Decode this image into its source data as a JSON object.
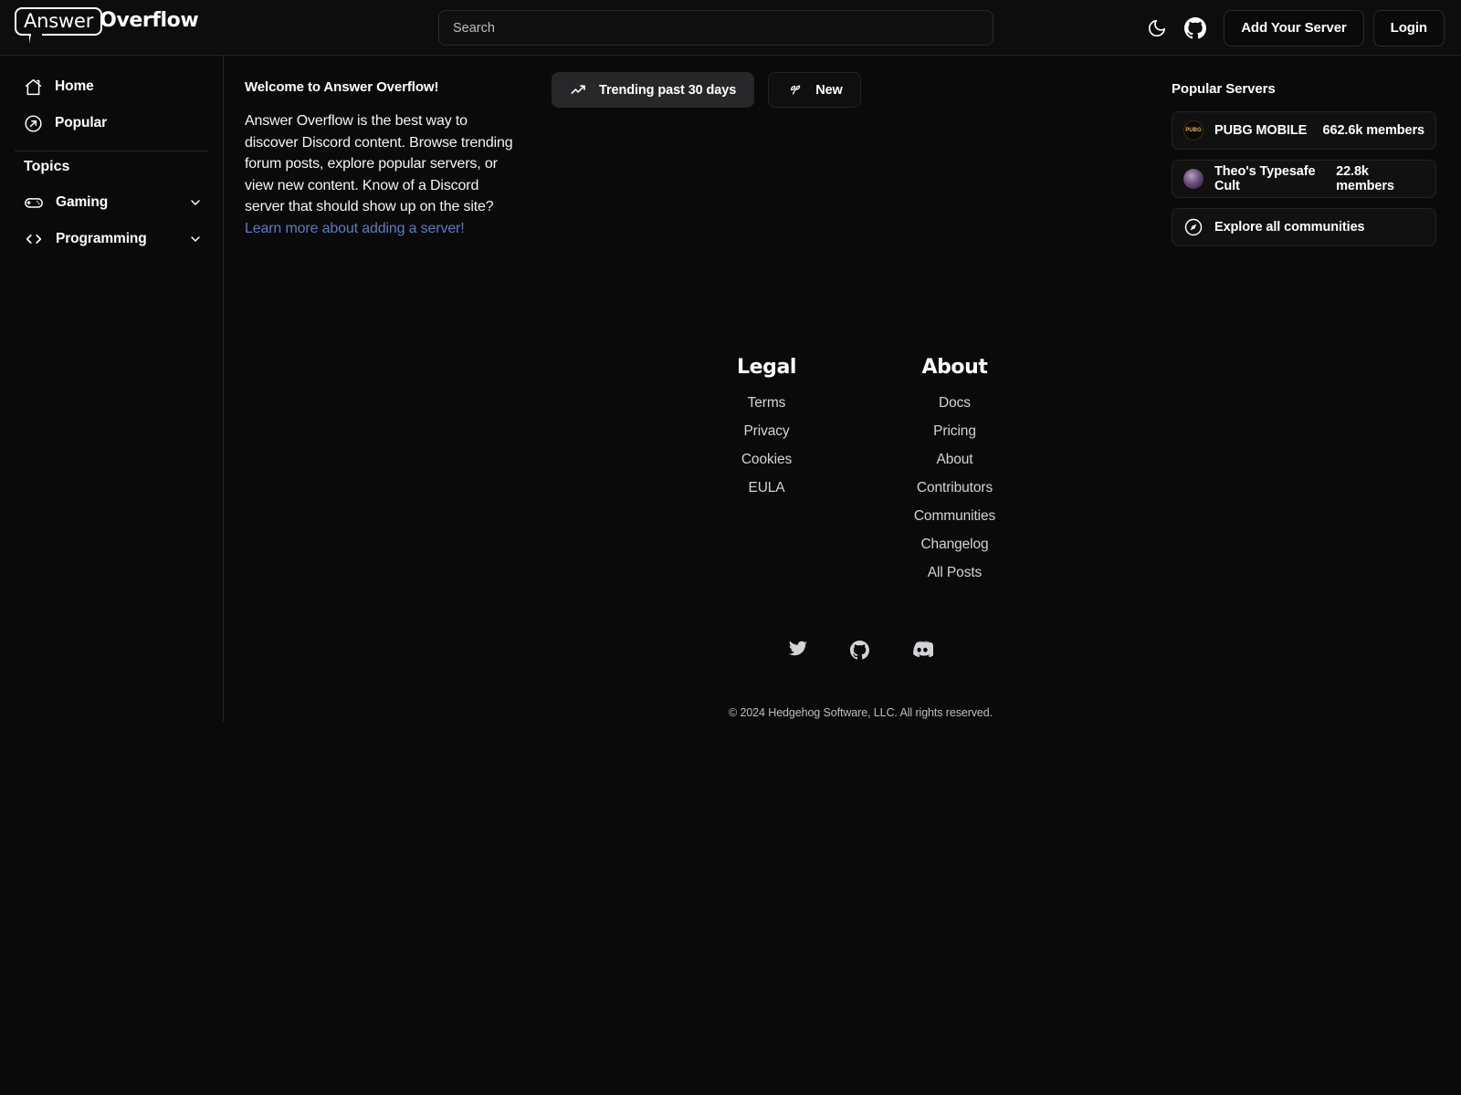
{
  "header": {
    "logo_primary": "Answer",
    "logo_secondary": "Overflow",
    "search_placeholder": "Search",
    "search_value": "",
    "theme_toggle_icon": "moon-icon",
    "github_icon": "github-icon",
    "add_server_label": "Add Your Server",
    "login_label": "Login"
  },
  "sidebar": {
    "nav": [
      {
        "label": "Home",
        "icon": "home-icon"
      },
      {
        "label": "Popular",
        "icon": "arrow-up-right-circle-icon"
      }
    ],
    "topics_title": "Topics",
    "topics": [
      {
        "label": "Gaming",
        "icon": "gamepad-icon",
        "chevron": "chevron-down-icon"
      },
      {
        "label": "Programming",
        "icon": "code-brackets-icon",
        "chevron": "chevron-down-icon"
      }
    ]
  },
  "main": {
    "welcome_title": "Welcome to Answer Overflow!",
    "welcome_body": "Answer Overflow is the best way to discover Discord content. Browse trending forum posts, explore popular servers, or view new content. Know of a Discord server that should show up on the site? ",
    "welcome_link": "Learn more about adding a server!",
    "tabs": [
      {
        "label": "Trending past 30 days",
        "icon": "trending-up-icon",
        "active": true
      },
      {
        "label": "New",
        "icon": "sprout-icon",
        "active": false
      }
    ]
  },
  "popular_servers": {
    "title": "Popular Servers",
    "servers": [
      {
        "name": "PUBG MOBILE",
        "members": "662.6k members",
        "avatar": "pubg-avatar",
        "avatar_text": "PUBG"
      },
      {
        "name": "Theo's Typesafe Cult",
        "members": "22.8k members",
        "avatar": "theo-avatar",
        "avatar_text": ""
      }
    ],
    "explore_label": "Explore all communities",
    "explore_icon": "compass-icon"
  },
  "footer": {
    "columns": [
      {
        "heading": "Legal",
        "links": [
          "Terms",
          "Privacy",
          "Cookies",
          "EULA"
        ]
      },
      {
        "heading": "About",
        "links": [
          "Docs",
          "Pricing",
          "About",
          "Contributors",
          "Communities",
          "Changelog",
          "All Posts"
        ]
      }
    ],
    "social": [
      {
        "name": "twitter-icon"
      },
      {
        "name": "github-icon"
      },
      {
        "name": "discord-icon"
      }
    ],
    "copyright": "© 2024 Hedgehog Software, LLC. All rights reserved."
  },
  "colors": {
    "background": "#0a0a0a",
    "panel": "#111111",
    "border": "#232323",
    "active_tab": "#27272a",
    "link": "#5b7cc4",
    "text": "#ffffff",
    "muted": "#d4d4d8"
  }
}
